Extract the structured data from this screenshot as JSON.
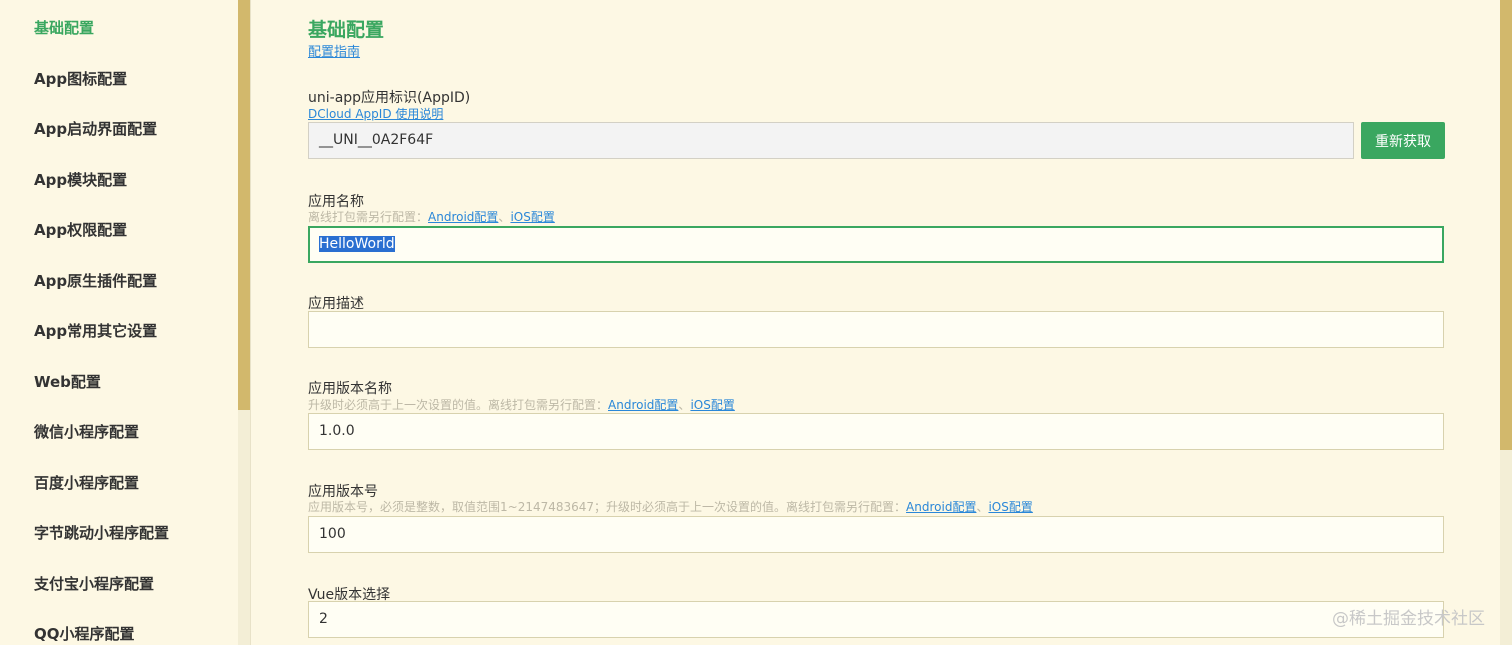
{
  "sidebar": {
    "items": [
      {
        "label": "基础配置",
        "active": true
      },
      {
        "label": "App图标配置"
      },
      {
        "label": "App启动界面配置"
      },
      {
        "label": "App模块配置"
      },
      {
        "label": "App权限配置"
      },
      {
        "label": "App原生插件配置"
      },
      {
        "label": "App常用其它设置"
      },
      {
        "label": "Web配置"
      },
      {
        "label": "微信小程序配置"
      },
      {
        "label": "百度小程序配置"
      },
      {
        "label": "字节跳动小程序配置"
      },
      {
        "label": "支付宝小程序配置"
      },
      {
        "label": "QQ小程序配置"
      }
    ]
  },
  "main": {
    "title": "基础配置",
    "guide_link": "配置指南",
    "appid": {
      "label": "uni-app应用标识(AppID)",
      "link": "DCloud AppID 使用说明",
      "value": "__UNI__0A2F64F",
      "button": "重新获取"
    },
    "app_name": {
      "label": "应用名称",
      "hint_prefix": "离线打包需另行配置：",
      "android_link": "Android配置",
      "sep": "、",
      "ios_link": "iOS配置",
      "value": "HelloWorld"
    },
    "app_desc": {
      "label": "应用描述",
      "value": ""
    },
    "version_name": {
      "label": "应用版本名称",
      "hint_prefix": "升级时必须高于上一次设置的值。离线打包需另行配置：",
      "android_link": "Android配置",
      "sep": "、",
      "ios_link": "iOS配置",
      "value": "1.0.0"
    },
    "version_code": {
      "label": "应用版本号",
      "hint_prefix": "应用版本号，必须是整数，取值范围1~2147483647；升级时必须高于上一次设置的值。离线打包需另行配置：",
      "android_link": "Android配置",
      "sep": "、",
      "ios_link": "iOS配置",
      "value": "100"
    },
    "vue_version": {
      "label": "Vue版本选择",
      "value": "2"
    }
  },
  "watermark": "@稀土掘金技术社区",
  "colors": {
    "accent": "#3aa760",
    "link": "#2a87d8",
    "background": "#fdf8e4",
    "scrollbar": "#d2b86c"
  }
}
